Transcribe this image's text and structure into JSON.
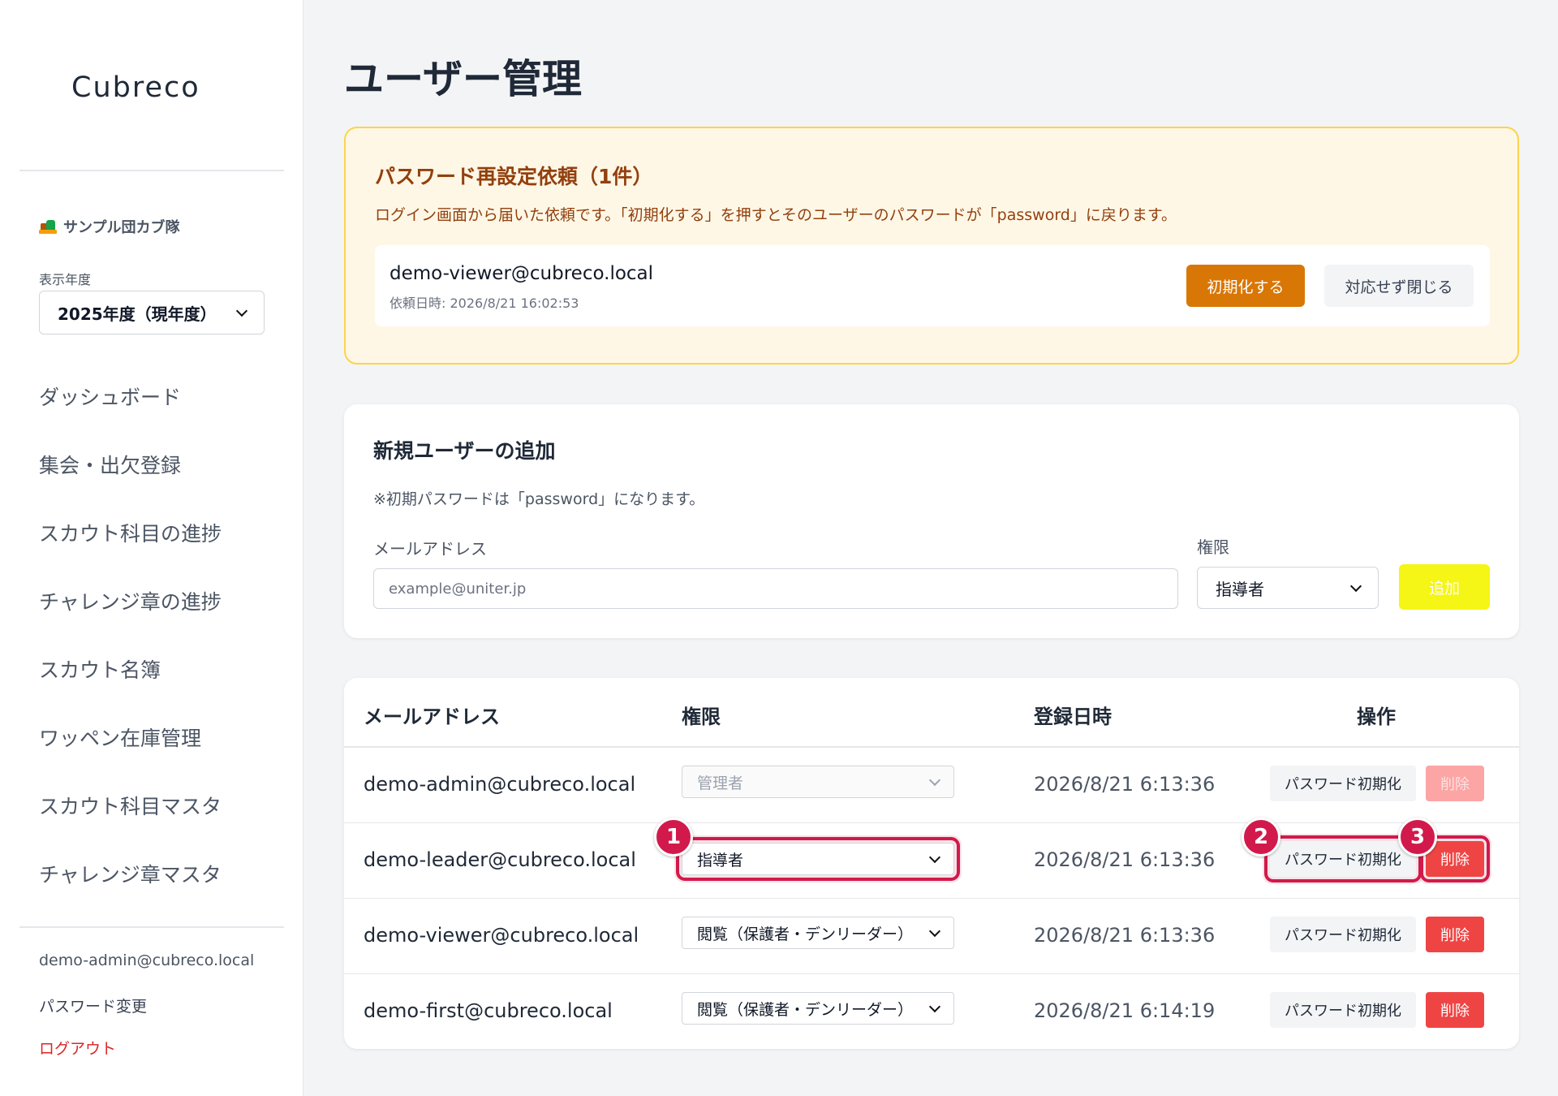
{
  "sidebar": {
    "logo": "Cubreco",
    "troop_name": "サンプル団カブ隊",
    "year_label": "表示年度",
    "year_value": "2025年度（現年度）",
    "nav": [
      "ダッシュボード",
      "集会・出欠登録",
      "スカウト科目の進捗",
      "チャレンジ章の進捗",
      "スカウト名簿",
      "ワッペン在庫管理",
      "スカウト科目マスタ",
      "チャレンジ章マスタ"
    ],
    "user_email": "demo-admin@cubreco.local",
    "password_change": "パスワード変更",
    "logout": "ログアウト"
  },
  "page": {
    "title": "ユーザー管理"
  },
  "reset_requests": {
    "title": "パスワード再設定依頼（1件）",
    "description": "ログイン画面から届いた依頼です。「初期化する」を押すとそのユーザーのパスワードが「password」に戻ります。",
    "items": [
      {
        "email": "demo-viewer@cubreco.local",
        "requested_at": "依頼日時: 2026/8/21 16:02:53",
        "init_label": "初期化する",
        "dismiss_label": "対応せず閉じる"
      }
    ]
  },
  "add_user": {
    "title": "新規ユーザーの追加",
    "note": "※初期パスワードは「password」になります。",
    "email_label": "メールアドレス",
    "email_placeholder": "example@uniter.jp",
    "role_label": "権限",
    "role_value": "指導者",
    "add_label": "追加"
  },
  "users_table": {
    "headers": {
      "email": "メールアドレス",
      "role": "権限",
      "created": "登録日時",
      "actions": "操作"
    },
    "reset_label": "パスワード初期化",
    "delete_label": "削除",
    "rows": [
      {
        "email": "demo-admin@cubreco.local",
        "role": "管理者",
        "created": "2026/8/21 6:13:36"
      },
      {
        "email": "demo-leader@cubreco.local",
        "role": "指導者",
        "created": "2026/8/21 6:13:36"
      },
      {
        "email": "demo-viewer@cubreco.local",
        "role": "閲覧（保護者・デンリーダー）",
        "created": "2026/8/21 6:13:36"
      },
      {
        "email": "demo-first@cubreco.local",
        "role": "閲覧（保護者・デンリーダー）",
        "created": "2026/8/21 6:14:19"
      }
    ]
  },
  "annotations": {
    "markers": [
      "1",
      "2",
      "3"
    ],
    "color": "#d11a4b"
  },
  "colors": {
    "primary_orange": "#d97706",
    "danger": "#ef4444",
    "add_button": "#f5f50a",
    "link_red": "#dc2626"
  }
}
